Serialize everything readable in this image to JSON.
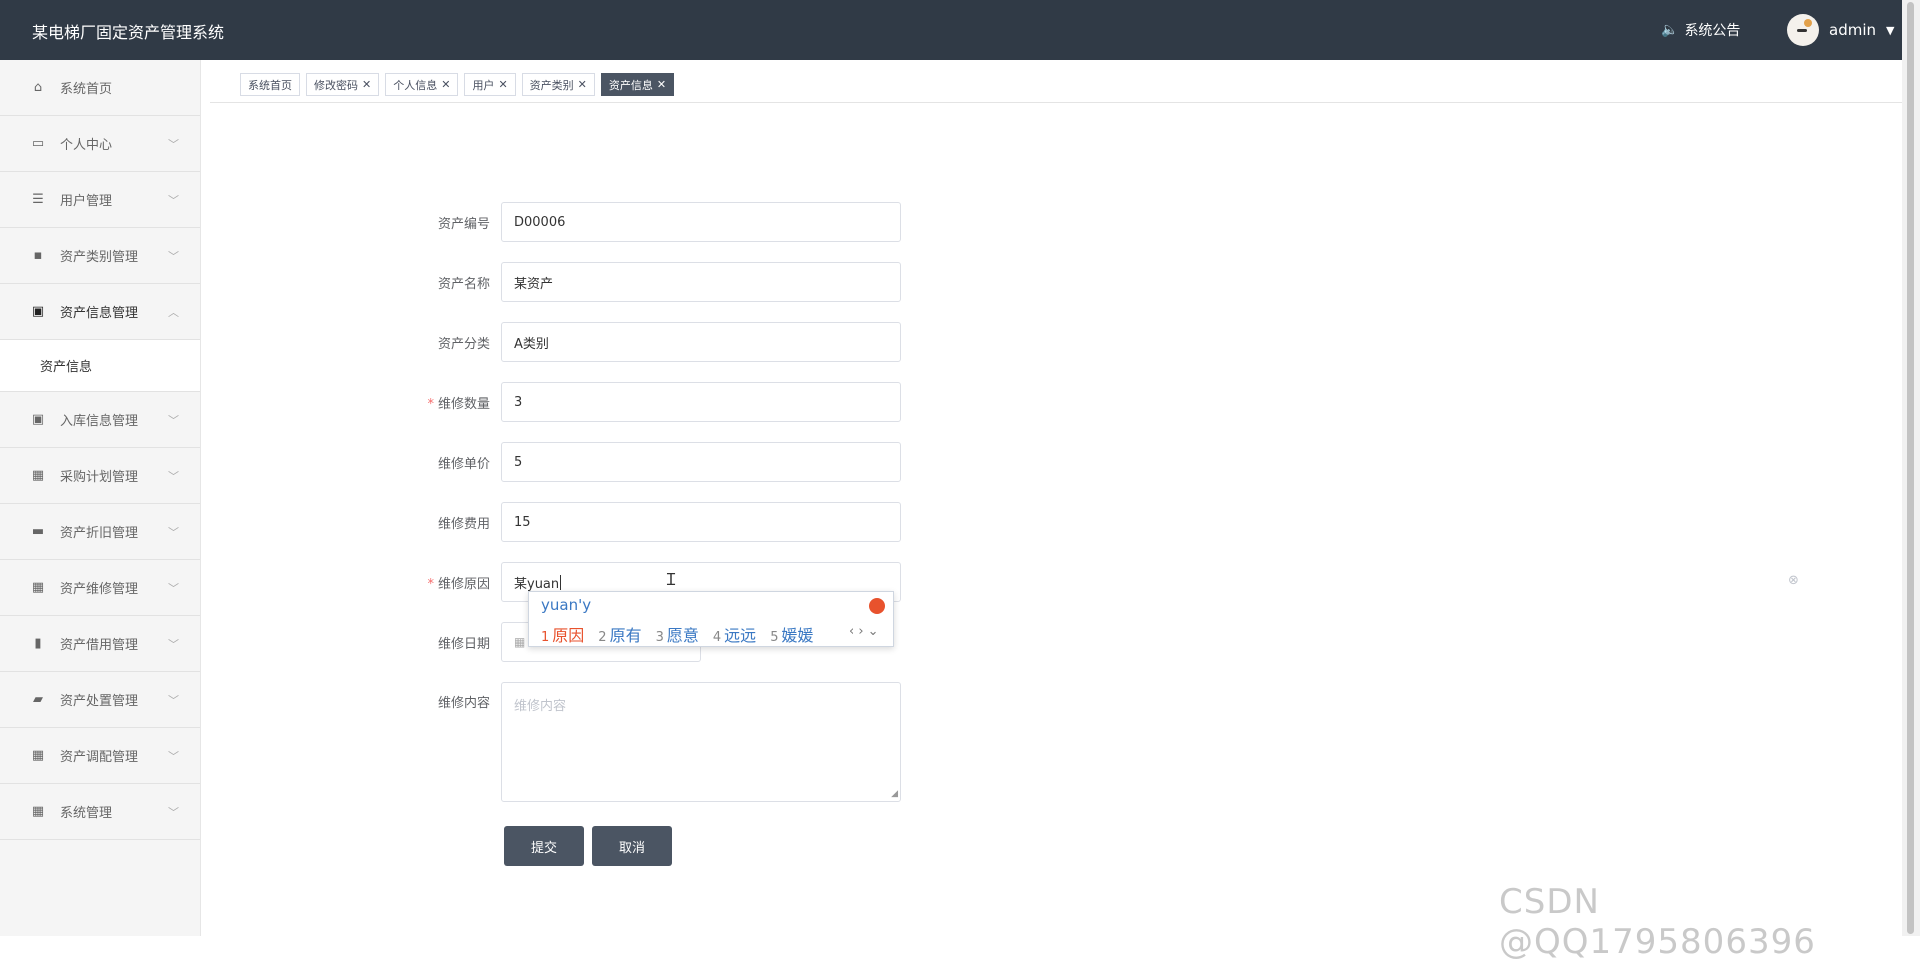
{
  "header": {
    "app_title": "某电梯厂固定资产管理系统",
    "notice_label": "系统公告",
    "username": "admin"
  },
  "sidebar": {
    "items": [
      {
        "label": "系统首页",
        "icon": "home-icon",
        "expandable": false
      },
      {
        "label": "个人中心",
        "icon": "card-icon",
        "expandable": true
      },
      {
        "label": "用户管理",
        "icon": "list-icon",
        "expandable": true
      },
      {
        "label": "资产类别管理",
        "icon": "chat-icon",
        "expandable": true
      },
      {
        "label": "资产信息管理",
        "icon": "clipboard-icon",
        "expandable": true,
        "open": true
      },
      {
        "label": "入库信息管理",
        "icon": "clipboard-check-icon",
        "expandable": true
      },
      {
        "label": "采购计划管理",
        "icon": "grid-icon",
        "expandable": true
      },
      {
        "label": "资产折旧管理",
        "icon": "monitor-icon",
        "expandable": true
      },
      {
        "label": "资产维修管理",
        "icon": "grid-icon",
        "expandable": true
      },
      {
        "label": "资产借用管理",
        "icon": "book-icon",
        "expandable": true
      },
      {
        "label": "资产处置管理",
        "icon": "ticket-icon",
        "expandable": true
      },
      {
        "label": "资产调配管理",
        "icon": "grid-icon",
        "expandable": true
      },
      {
        "label": "系统管理",
        "icon": "grid-icon",
        "expandable": true
      }
    ],
    "submenu": {
      "label": "资产信息"
    }
  },
  "tabs": [
    {
      "label": "系统首页",
      "closable": false,
      "active": false
    },
    {
      "label": "修改密码",
      "closable": true,
      "active": false
    },
    {
      "label": "个人信息",
      "closable": true,
      "active": false
    },
    {
      "label": "用户",
      "closable": true,
      "active": false
    },
    {
      "label": "资产类别",
      "closable": true,
      "active": false
    },
    {
      "label": "资产信息",
      "closable": true,
      "active": true
    }
  ],
  "form": {
    "asset_no": {
      "label": "资产编号",
      "value": "D00006"
    },
    "asset_name": {
      "label": "资产名称",
      "value": "某资产"
    },
    "asset_category": {
      "label": "资产分类",
      "value": "A类别"
    },
    "repair_qty": {
      "label": "维修数量",
      "value": "3",
      "required": true
    },
    "repair_price": {
      "label": "维修单价",
      "value": "5"
    },
    "repair_cost": {
      "label": "维修费用",
      "value": "15"
    },
    "repair_reason": {
      "label": "维修原因",
      "value": "某yuan",
      "required": true
    },
    "repair_date": {
      "label": "维修日期",
      "value": ""
    },
    "repair_content": {
      "label": "维修内容",
      "placeholder": "维修内容"
    },
    "submit_label": "提交",
    "cancel_label": "取消"
  },
  "ime": {
    "composition": "yuan'y",
    "candidates": [
      {
        "n": "1",
        "text": "原因"
      },
      {
        "n": "2",
        "text": "原有"
      },
      {
        "n": "3",
        "text": "愿意"
      },
      {
        "n": "4",
        "text": "远远"
      },
      {
        "n": "5",
        "text": "媛媛"
      }
    ],
    "nav": "‹ › ⌄"
  },
  "watermark": "CSDN @QQ1795806396",
  "colors": {
    "header_bg": "#303a46",
    "active_tab": "#4b5563",
    "required": "#f56c6c",
    "ime_accent": "#3a78c3"
  }
}
